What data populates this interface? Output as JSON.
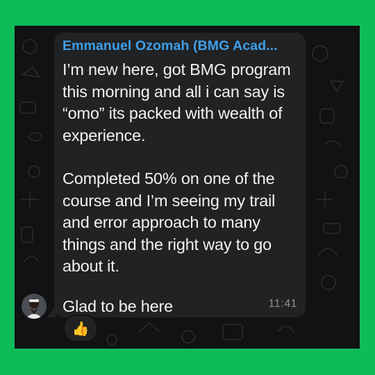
{
  "chat": {
    "message": {
      "sender": "Emmanuel Ozomah (BMG Acad...",
      "paragraph_1": "I’m new here, got BMG program this morning and all i can say is “omo” its packed with wealth of experience.",
      "paragraph_2": "Completed 50% on one of the course and I’m seeing my trail and error approach to many things and the right way to go about it.",
      "paragraph_3": "Glad to be here",
      "time": "11:41",
      "reaction": "👍"
    },
    "avatar_icon": "person-avatar-icon"
  },
  "colors": {
    "outer_background": "#0fbb57",
    "chat_background": "#111213",
    "bubble": "#202224",
    "sender_name": "#3f9fe8",
    "message_text": "#f2f2f2",
    "timestamp": "#8e9093"
  }
}
